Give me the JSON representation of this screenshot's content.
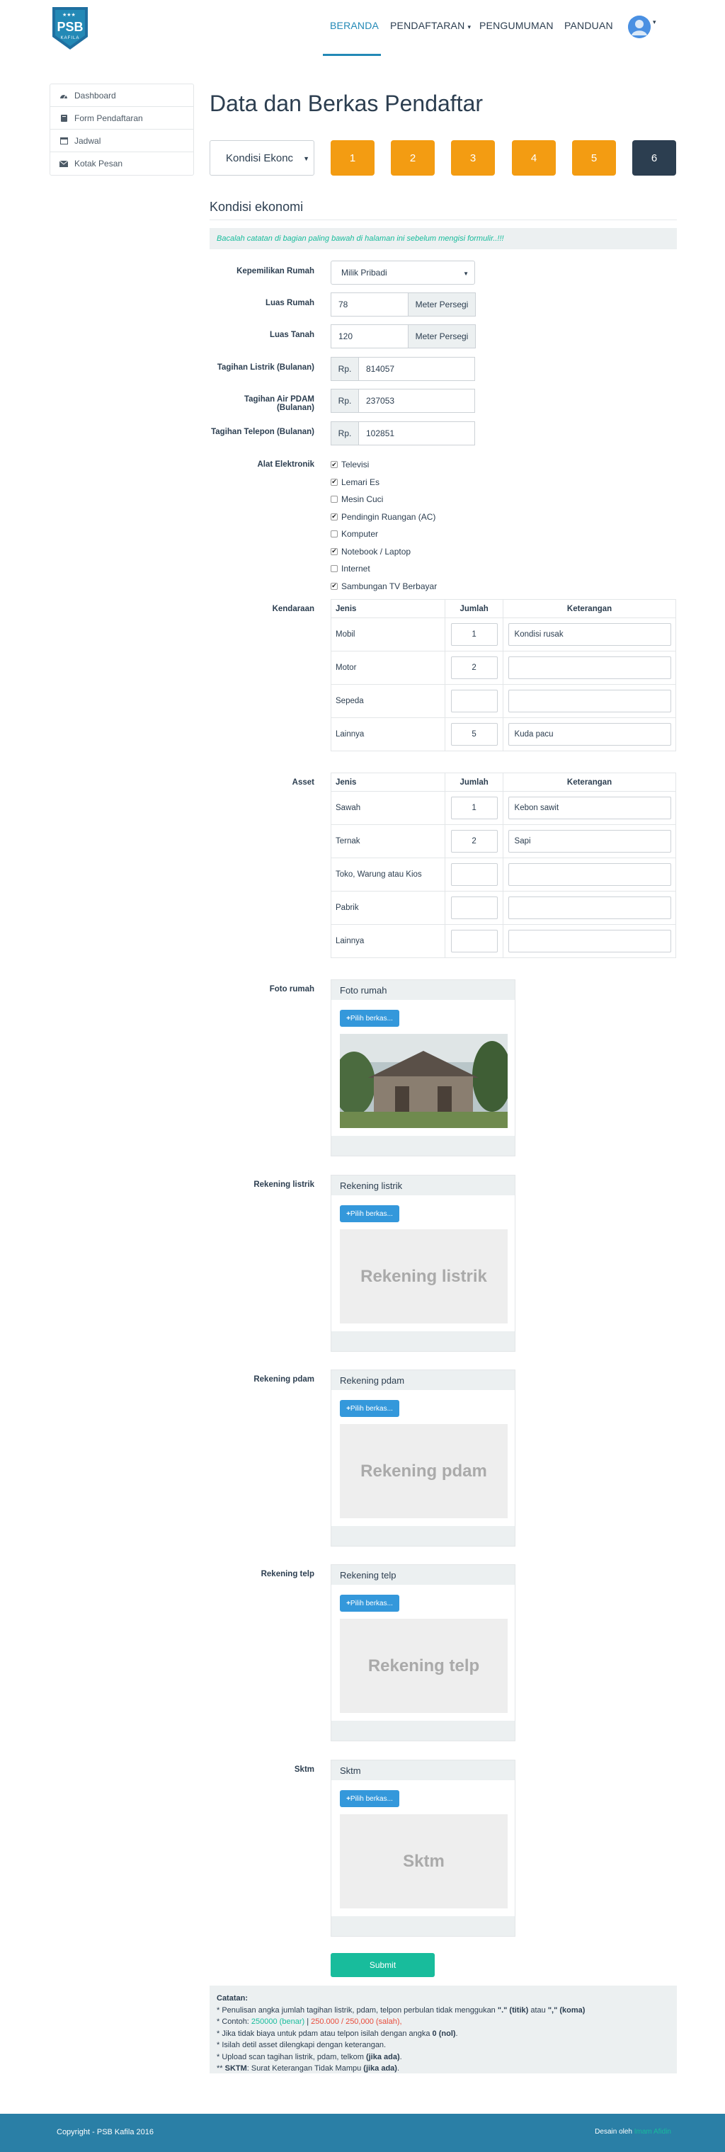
{
  "nav": {
    "logo_text": "PSB",
    "logo_sub": "KAFILA",
    "items": [
      "BERANDA",
      "PENDAFTARAN",
      "PENGUMUMAN",
      "PANDUAN"
    ],
    "pendaftaran_caret": "▾"
  },
  "sidebar": {
    "items": [
      {
        "label": "Dashboard",
        "icon": "dashboard-icon"
      },
      {
        "label": "Form Pendaftaran",
        "icon": "book-icon"
      },
      {
        "label": "Jadwal",
        "icon": "calendar-icon"
      },
      {
        "label": "Kotak Pesan",
        "icon": "envelope-icon"
      }
    ]
  },
  "main": {
    "title": "Data dan Berkas Pendaftar",
    "step_select": "Kondisi Ekonc",
    "steps": [
      "1",
      "2",
      "3",
      "4",
      "5",
      "6"
    ],
    "section_title": "Kondisi ekonomi",
    "alert": "Bacalah catatan di bagian paling bawah di halaman ini sebelum mengisi formulir..!!!"
  },
  "form": {
    "kepemilikan": {
      "label": "Kepemilikan Rumah",
      "value": "Milik Pribadi"
    },
    "luas_rumah": {
      "label": "Luas Rumah",
      "value": "78",
      "unit": "Meter Persegi"
    },
    "luas_tanah": {
      "label": "Luas Tanah",
      "value": "120",
      "unit": "Meter Persegi"
    },
    "listrik": {
      "label": "Tagihan Listrik (Bulanan)",
      "prefix": "Rp.",
      "value": "814057"
    },
    "air": {
      "label": "Tagihan Air PDAM (Bulanan)",
      "prefix": "Rp.",
      "value": "237053"
    },
    "telepon": {
      "label": "Tagihan Telepon (Bulanan)",
      "prefix": "Rp.",
      "value": "102851"
    },
    "elektronik": {
      "label": "Alat Elektronik",
      "items": [
        {
          "label": "Televisi",
          "checked": true
        },
        {
          "label": "Lemari Es",
          "checked": true
        },
        {
          "label": "Mesin Cuci",
          "checked": false
        },
        {
          "label": "Pendingin Ruangan (AC)",
          "checked": true
        },
        {
          "label": "Komputer",
          "checked": false
        },
        {
          "label": "Notebook / Laptop",
          "checked": true
        },
        {
          "label": "Internet",
          "checked": false
        },
        {
          "label": "Sambungan TV Berbayar",
          "checked": true
        }
      ]
    },
    "kendaraan": {
      "label": "Kendaraan",
      "headers": [
        "Jenis",
        "Jumlah",
        "Keterangan"
      ],
      "rows": [
        {
          "jenis": "Mobil",
          "jumlah": "1",
          "ket": "Kondisi rusak"
        },
        {
          "jenis": "Motor",
          "jumlah": "2",
          "ket": ""
        },
        {
          "jenis": "Sepeda",
          "jumlah": "",
          "ket": ""
        },
        {
          "jenis": "Lainnya",
          "jumlah": "5",
          "ket": "Kuda pacu"
        }
      ]
    },
    "asset": {
      "label": "Asset",
      "headers": [
        "Jenis",
        "Jumlah",
        "Keterangan"
      ],
      "rows": [
        {
          "jenis": "Sawah",
          "jumlah": "1",
          "ket": "Kebon sawit"
        },
        {
          "jenis": "Ternak",
          "jumlah": "2",
          "ket": "Sapi"
        },
        {
          "jenis": "Toko, Warung atau Kios",
          "jumlah": "",
          "ket": ""
        },
        {
          "jenis": "Pabrik",
          "jumlah": "",
          "ket": ""
        },
        {
          "jenis": "Lainnya",
          "jumlah": "",
          "ket": ""
        }
      ]
    },
    "uploads": [
      {
        "label": "Foto rumah",
        "head": "Foto rumah",
        "button": "Pilih berkas...",
        "placeholder": "",
        "has_photo": true
      },
      {
        "label": "Rekening listrik",
        "head": "Rekening listrik",
        "button": "Pilih berkas...",
        "placeholder": "Rekening listrik",
        "has_photo": false
      },
      {
        "label": "Rekening pdam",
        "head": "Rekening pdam",
        "button": "Pilih berkas...",
        "placeholder": "Rekening pdam",
        "has_photo": false
      },
      {
        "label": "Rekening telp",
        "head": "Rekening telp",
        "button": "Pilih berkas...",
        "placeholder": "Rekening telp",
        "has_photo": false
      },
      {
        "label": "Sktm",
        "head": "Sktm",
        "button": "Pilih berkas...",
        "placeholder": "Sktm",
        "has_photo": false
      }
    ],
    "submit": "Submit"
  },
  "notes": {
    "title": "Catatan:",
    "line1_a": "* Penulisan angka jumlah tagihan listrik, pdam, telpon perbulan tidak menggukan ",
    "line1_b": "\".\" (titik)",
    "line1_c": " atau ",
    "line1_d": "\",\" (koma)",
    "line2_a": "* Contoh: ",
    "line2_ok": "250000 (benar)",
    "line2_sep": " | ",
    "line2_bad": "250.000 / 250,000 (salah),",
    "line3_a": "* Jika tidak biaya untuk pdam atau telpon isilah dengan angka ",
    "line3_b": "0 (nol)",
    "line3_c": ".",
    "line4": "* Isilah detil asset dilengkapi dengan keterangan.",
    "line5_a": "* Upload scan tagihan listrik, pdam, telkom ",
    "line5_b": "(jika ada)",
    "line5_c": ".",
    "line6_a": "** ",
    "line6_b": "SKTM",
    "line6_c": ": Surat Keterangan Tidak Mampu ",
    "line6_d": "(jika ada)",
    "line6_e": "."
  },
  "footer": {
    "copyright": "Copyright - PSB Kafila 2016",
    "design_prefix": "Desain oleh ",
    "design_link": "Imam Afidin"
  },
  "colors": {
    "primary": "#2389b6",
    "orange": "#f39c12",
    "dark": "#2c3e50",
    "green": "#18bc9c",
    "blue": "#3498db"
  }
}
